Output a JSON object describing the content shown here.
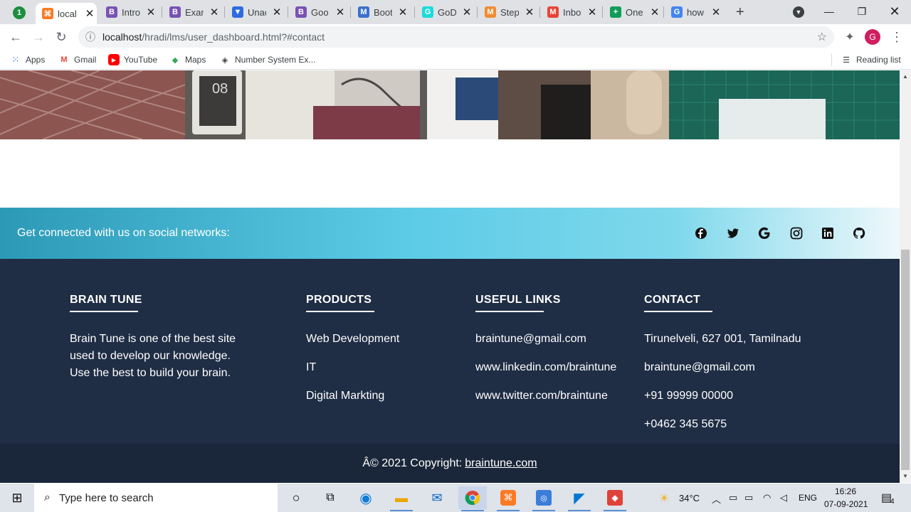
{
  "browser": {
    "tabs": [
      {
        "title": "local",
        "icon": "xampp-icon",
        "color": "#fb7a24",
        "glyph": "⌘",
        "active": true
      },
      {
        "title": "Intro",
        "icon": "bootstrap-icon",
        "color": "#7952b3",
        "glyph": "B"
      },
      {
        "title": "Exam",
        "icon": "bootstrap-icon",
        "color": "#7952b3",
        "glyph": "B"
      },
      {
        "title": "Unac",
        "icon": "funnel-icon",
        "color": "#2d6cdf",
        "glyph": "▼"
      },
      {
        "title": "Goo",
        "icon": "bootstrap-icon",
        "color": "#7952b3",
        "glyph": "B"
      },
      {
        "title": "Boot",
        "icon": "mdb-icon",
        "color": "#3b71ca",
        "glyph": "M"
      },
      {
        "title": "GoD",
        "icon": "godaddy-icon",
        "color": "#1bdbdb",
        "glyph": "G"
      },
      {
        "title": "Step",
        "icon": "m-icon",
        "color": "#f28b30",
        "glyph": "M"
      },
      {
        "title": "Inbo",
        "icon": "gmail-icon",
        "color": "#ea4335",
        "glyph": "M"
      },
      {
        "title": "One",
        "icon": "sheets-icon",
        "color": "#0f9d58",
        "glyph": "+"
      },
      {
        "title": "how",
        "icon": "google-icon",
        "color": "#4285f4",
        "glyph": "G"
      }
    ],
    "badge": "1",
    "url_host": "localhost",
    "url_path": "/hradi/lms/user_dashboard.html?#contact",
    "profile_initial": "G",
    "bookmarks": [
      {
        "label": "Apps",
        "icon": "apps-grid-icon"
      },
      {
        "label": "Gmail",
        "icon": "gmail-icon"
      },
      {
        "label": "YouTube",
        "icon": "youtube-icon"
      },
      {
        "label": "Maps",
        "icon": "maps-icon"
      },
      {
        "label": "Number System Ex...",
        "icon": "diamond-icon"
      }
    ],
    "reading_list": "Reading list"
  },
  "page": {
    "social_text": "Get connected with us on social networks:",
    "social_icons": [
      "facebook-icon",
      "twitter-icon",
      "google-icon",
      "instagram-icon",
      "linkedin-icon",
      "github-icon"
    ],
    "footer": {
      "brand": {
        "heading": "BRAIN TUNE",
        "lines": [
          "Brain Tune is one of the best site",
          "used to develop our knowledge.",
          "Use the best to build your brain."
        ]
      },
      "products": {
        "heading": "PRODUCTS",
        "items": [
          "Web Development",
          "IT",
          "Digital Markting"
        ]
      },
      "useful_links": {
        "heading": "USEFUL LINKS",
        "items": [
          "braintune@gmail.com",
          "www.linkedin.com/braintune",
          "www.twitter.com/braintune"
        ]
      },
      "contact": {
        "heading": "CONTACT",
        "items": [
          "Tirunelveli, 627 001, Tamilnadu",
          "braintune@gmail.com",
          "+91 99999 00000",
          "+0462 345 5675"
        ]
      }
    },
    "copyright_prefix": "Â© 2021 Copyright:",
    "copyright_link": "braintune.com",
    "footer_bg": "#1f2d45"
  },
  "taskbar": {
    "search_placeholder": "Type here to search",
    "weather": "34°C",
    "lang": "ENG",
    "time": "16:26",
    "date": "07-09-2021",
    "notifications": "4"
  }
}
